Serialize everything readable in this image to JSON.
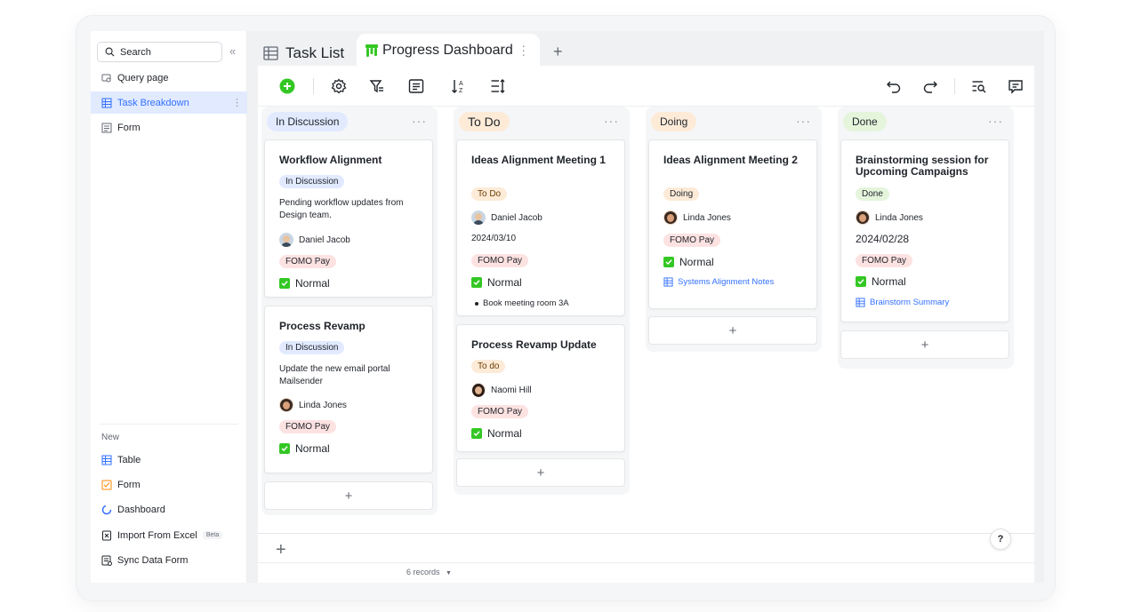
{
  "sidebar": {
    "search_placeholder": "Search",
    "items": [
      {
        "label": "Query page",
        "icon": "query-icon"
      },
      {
        "label": "Task Breakdown",
        "icon": "table-icon"
      },
      {
        "label": "Form",
        "icon": "form-icon"
      }
    ],
    "new_section": "New",
    "new_items": [
      {
        "label": "Table",
        "icon": "table-icon"
      },
      {
        "label": "Form",
        "icon": "form-icon"
      },
      {
        "label": "Dashboard",
        "icon": "dashboard-icon"
      },
      {
        "label": "Import From Excel",
        "icon": "excel-icon",
        "badge": "Beta"
      },
      {
        "label": "Sync Data Form",
        "icon": "sync-icon"
      }
    ]
  },
  "tabs": {
    "list": "Task List",
    "active": "Progress Dashboard"
  },
  "columns": [
    {
      "title": "In Discussion",
      "color": "#e1eaff"
    },
    {
      "title": "To Do",
      "color": "#fdebd8"
    },
    {
      "title": "Doing",
      "color": "#fdebd8"
    },
    {
      "title": "Done",
      "color": "#e4f5dc"
    }
  ],
  "cards": {
    "c1": {
      "title": "Workflow Alignment",
      "status": "In Discussion",
      "desc": "Pending workflow updates from Design team.",
      "person": "Daniel Jacob",
      "project": "FOMO Pay",
      "priority": "Normal"
    },
    "c2": {
      "title": "Process Revamp",
      "status": "In Discussion",
      "desc": "Update the new email portal Mailsender",
      "person": "Linda Jones",
      "project": "FOMO Pay",
      "priority": "Normal"
    },
    "c3": {
      "title": "Ideas Alignment Meeting 1",
      "status": "To Do",
      "person": "Daniel Jacob",
      "date": "2024/03/10",
      "project": "FOMO Pay",
      "priority": "Normal",
      "bullet": "Book meeting room 3A"
    },
    "c4": {
      "title": "Process Revamp Update",
      "status": "To do",
      "person": "Naomi Hill",
      "project": "FOMO Pay",
      "priority": "Normal"
    },
    "c5": {
      "title": "Ideas Alignment Meeting 2",
      "status": "Doing",
      "person": "Linda Jones",
      "project": "FOMO Pay",
      "priority": "Normal",
      "link": "Systems Alignment Notes"
    },
    "c6": {
      "title": "Brainstorming session for Upcoming Campaigns",
      "status": "Done",
      "person": "Linda Jones",
      "date": "2024/02/28",
      "project": "FOMO Pay",
      "priority": "Normal",
      "link": "Brainstorm Summary"
    }
  },
  "footer": {
    "records": "6 records",
    "help": "?"
  },
  "colors": {
    "accent": "#3370ff",
    "add_green": "#34c724"
  }
}
